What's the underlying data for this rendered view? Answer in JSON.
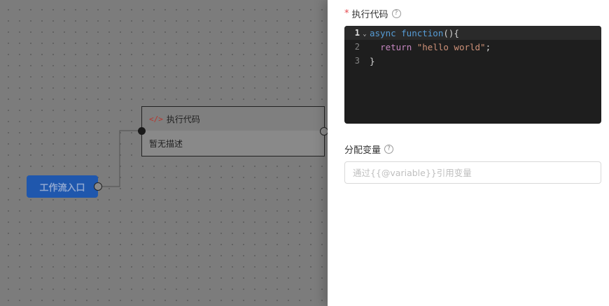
{
  "canvas": {
    "entry_node": {
      "label": "工作流入口"
    },
    "code_node": {
      "icon": "code-tag-icon",
      "icon_glyph": "</>",
      "title": "执行代码",
      "description": "暂无描述"
    }
  },
  "panel": {
    "code_field": {
      "required_mark": "*",
      "label": "执行代码",
      "help": "?",
      "lines": [
        {
          "no": "1",
          "text": "async function(){"
        },
        {
          "no": "2",
          "text": "  return \"hello world\";"
        },
        {
          "no": "3",
          "text": "}"
        }
      ]
    },
    "var_field": {
      "label": "分配变量",
      "help": "?",
      "placeholder": "通过{{@variable}}引用变量",
      "value": ""
    }
  }
}
